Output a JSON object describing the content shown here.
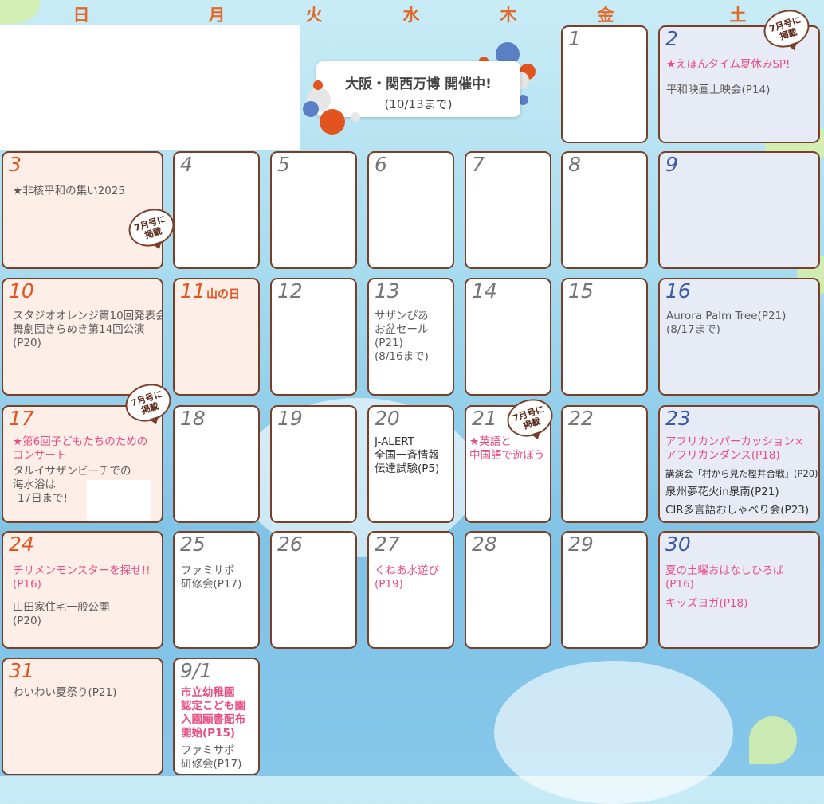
{
  "weekdays": [
    "日",
    "月",
    "火",
    "水",
    "木",
    "金",
    "土"
  ],
  "banner": {
    "title": "大阪・関西万博 開催中!",
    "sub": "(10/13まで)"
  },
  "badge_text": [
    "7月号に",
    "掲載"
  ],
  "days": {
    "d1": {
      "num": "1"
    },
    "d2": {
      "num": "2",
      "ev1": "★えほんタイム夏休みSP!",
      "ev2": "平和映画上映会(P14)"
    },
    "d3": {
      "num": "3",
      "ev1": "★非核平和の集い2025"
    },
    "d4": {
      "num": "4"
    },
    "d5": {
      "num": "5"
    },
    "d6": {
      "num": "6"
    },
    "d7": {
      "num": "7"
    },
    "d8": {
      "num": "8"
    },
    "d9": {
      "num": "9"
    },
    "d10": {
      "num": "10",
      "ev1": "スタジオオレンジ第10回発表会",
      "ev2": "舞劇団きらめき第14回公演",
      "ev3": "(P20)"
    },
    "d11": {
      "num": "11",
      "holiday": "山の日"
    },
    "d12": {
      "num": "12"
    },
    "d13": {
      "num": "13",
      "ev1": "サザンぴあ",
      "ev2": "お盆セール",
      "ev3": "(P21)",
      "ev4": "(8/16まで)"
    },
    "d14": {
      "num": "14"
    },
    "d15": {
      "num": "15"
    },
    "d16": {
      "num": "16",
      "ev1": "Aurora Palm Tree(P21)",
      "ev2": "(8/17まで)"
    },
    "d17": {
      "num": "17",
      "ev1": "★第6回子どもたちのための",
      "ev2": "コンサート",
      "ev3": "タルイサザンビーチでの",
      "ev4": "海水浴は",
      "ev5": "17日まで!"
    },
    "d18": {
      "num": "18"
    },
    "d19": {
      "num": "19"
    },
    "d20": {
      "num": "20",
      "ev1": "J-ALERT",
      "ev2": "全国一斉情報",
      "ev3": "伝達試験(P5)"
    },
    "d21": {
      "num": "21",
      "ev1": "★英語と",
      "ev2": "中国語で遊ぼう"
    },
    "d22": {
      "num": "22"
    },
    "d23": {
      "num": "23",
      "ev1": "アフリカンパーカッション×",
      "ev2": "アフリカンダンス(P18)",
      "ev3": "講演会「村から見た樫井合戦」(P20)",
      "ev4": "泉州夢花火in泉南(P21)",
      "ev5": "CIR多言語おしゃべり会(P23)"
    },
    "d24": {
      "num": "24",
      "ev1": "チリメンモンスターを探せ!!",
      "ev2": "(P16)",
      "ev3": "山田家住宅一般公開",
      "ev4": "(P20)"
    },
    "d25": {
      "num": "25",
      "ev1": "ファミサポ",
      "ev2": "研修会(P17)"
    },
    "d26": {
      "num": "26"
    },
    "d27": {
      "num": "27",
      "ev1": "くねあ水遊び",
      "ev2": "(P19)"
    },
    "d28": {
      "num": "28"
    },
    "d29": {
      "num": "29"
    },
    "d30": {
      "num": "30",
      "ev1": "夏の土曜おはなしひろば",
      "ev2": "(P16)",
      "ev3": "キッズヨガ(P18)"
    },
    "d31": {
      "num": "31",
      "ev1": "わいわい夏祭り(P21)"
    },
    "d91": {
      "num": "9/1",
      "ev1": "市立幼稚園",
      "ev2": "認定こども園",
      "ev3": "入園願書配布",
      "ev4": "開始(P15)",
      "ev5": "ファミサポ",
      "ev6": "研修会(P17)"
    }
  },
  "colors": {
    "frame": "#7b3f27",
    "sunday": "#e2541f",
    "saturday": "#3b5aa5",
    "pink_event": "#e84d83"
  }
}
